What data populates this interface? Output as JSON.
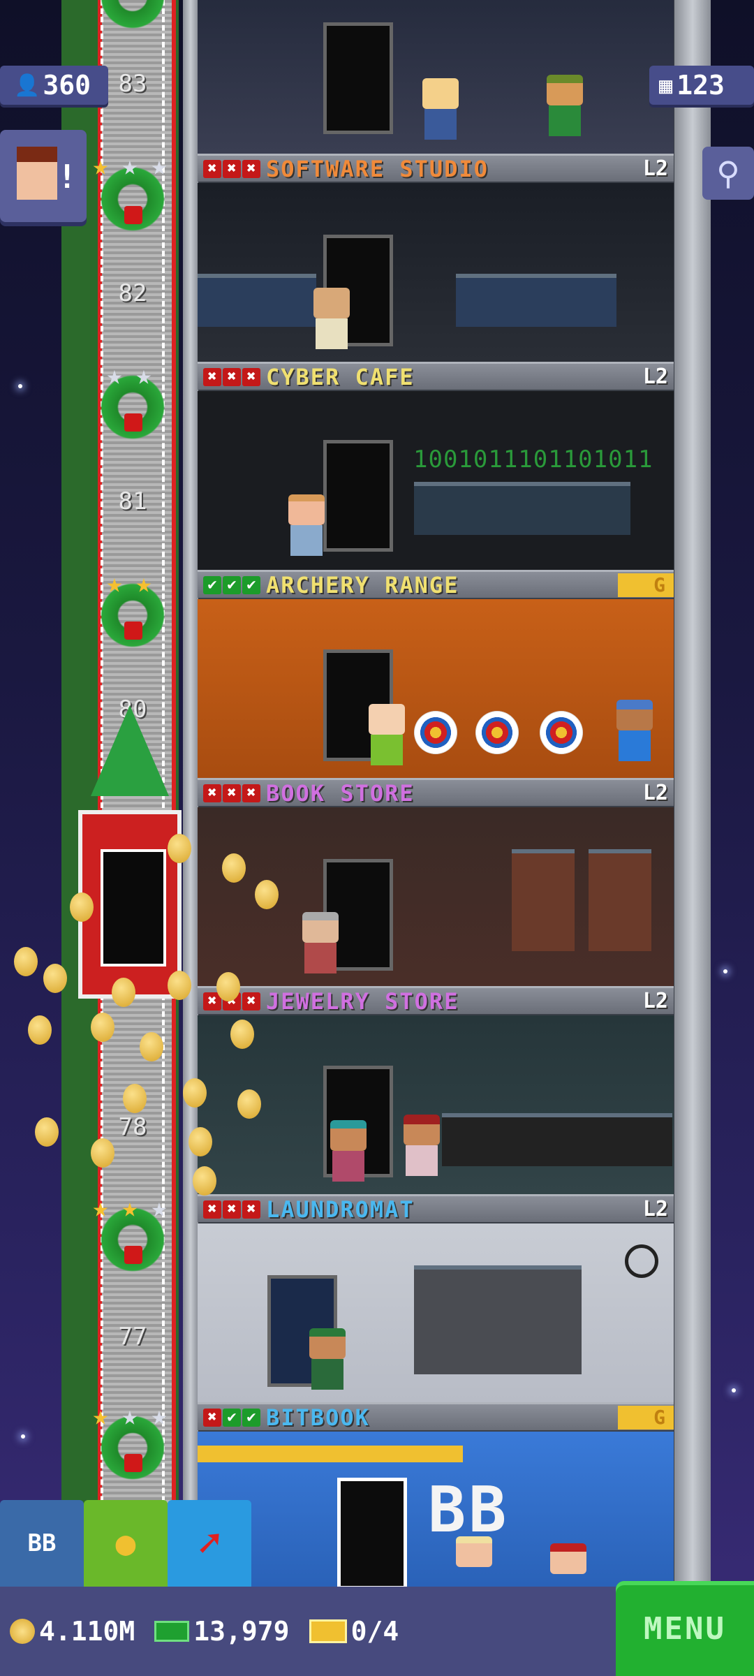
{
  "hud": {
    "population": "360",
    "floors": "123",
    "population_icon": "person-icon",
    "floors_icon": "building-icon",
    "notification_mark": "!"
  },
  "shaft": {
    "floor_numbers": [
      "83",
      "82",
      "81",
      "80",
      "78",
      "77"
    ]
  },
  "floors": [
    {
      "name": "SOFTWARE STUDIO",
      "color": "#f08a3a",
      "marks": [
        "x",
        "x",
        "x"
      ],
      "level": "L2"
    },
    {
      "name": "CYBER CAFE",
      "color": "#f0e070",
      "marks": [
        "x",
        "x",
        "x"
      ],
      "level": "L2"
    },
    {
      "name": "ARCHERY RANGE",
      "color": "#f0e070",
      "marks": [
        "v",
        "v",
        "v"
      ],
      "level": "G"
    },
    {
      "name": "BOOK STORE",
      "color": "#d070e0",
      "marks": [
        "x",
        "x",
        "x"
      ],
      "level": "L2"
    },
    {
      "name": "JEWELRY STORE",
      "color": "#d070e0",
      "marks": [
        "x",
        "x",
        "x"
      ],
      "level": "L2"
    },
    {
      "name": "LAUNDROMAT",
      "color": "#4ab8f0",
      "marks": [
        "x",
        "x",
        "x"
      ],
      "level": "L2"
    },
    {
      "name": "BITBOOK",
      "color": "#4ab8f0",
      "marks": [
        "x",
        "v",
        "v"
      ],
      "level": "G"
    }
  ],
  "cyber_cafe_code": "1001011101101011",
  "bitbook_sign": "BB",
  "toolbar": {
    "bb_label": "BB",
    "coins": "4.110M",
    "bux": "13,979",
    "tickets": "0/4",
    "menu_label": "MENU"
  },
  "colors": {
    "mark_x": "#c41818",
    "mark_v": "#1c9c2a",
    "menu_bg": "#22b030",
    "status_bg": "#474a7e"
  }
}
